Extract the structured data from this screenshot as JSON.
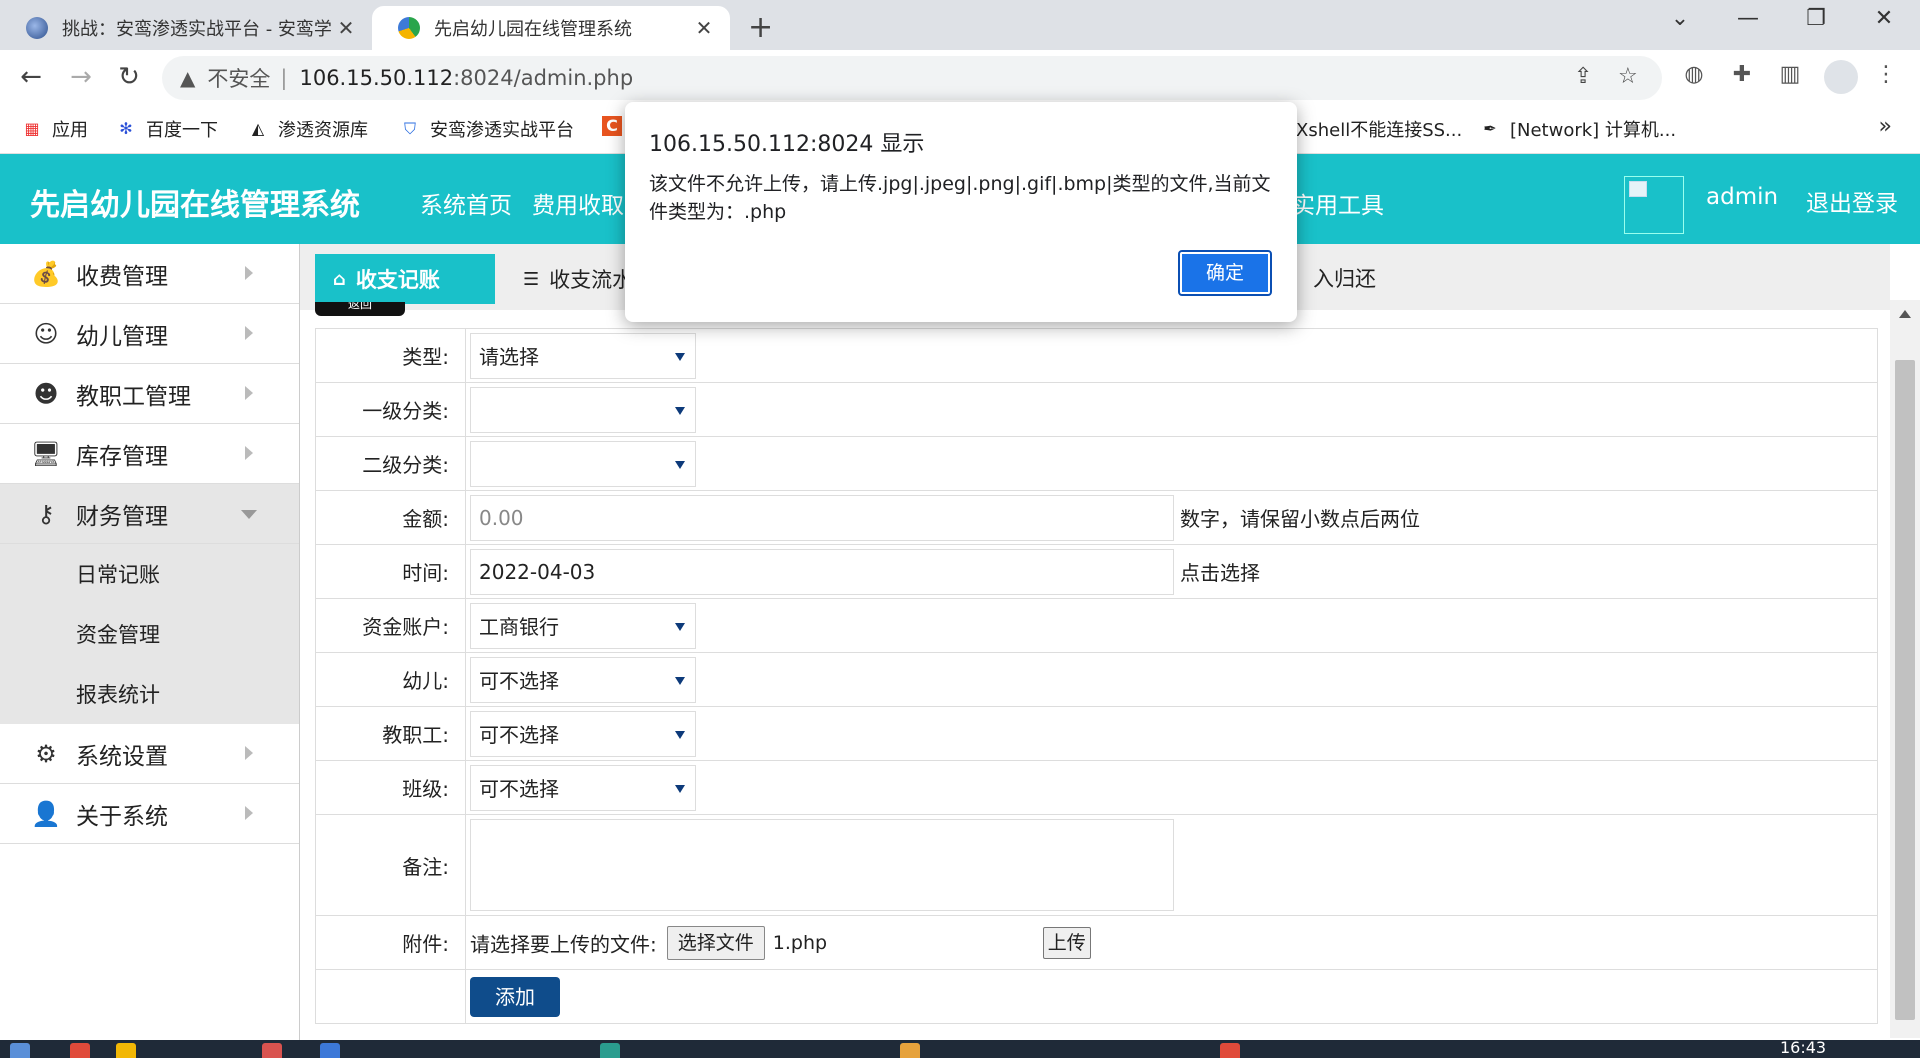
{
  "browser": {
    "tabs": [
      {
        "title": "挑战：安鸾渗透实战平台 - 安鸾学",
        "active": false
      },
      {
        "title": "先启幼儿园在线管理系统",
        "active": true
      }
    ],
    "address": {
      "security_label": "不安全",
      "host": "106.15.50.112",
      "path": ":8024/admin.php"
    },
    "bookmarks": [
      {
        "label": "应用",
        "icon": "apps-grid-icon"
      },
      {
        "label": "百度一下",
        "icon": "baidu-paw-icon"
      },
      {
        "label": "渗透资源库",
        "icon": "wolf-icon"
      },
      {
        "label": "安鸾渗透实战平台",
        "icon": "shield-icon"
      },
      {
        "label": "C",
        "icon": "csdn-icon"
      },
      {
        "label": "Xshell不能连接SS...",
        "icon": "none"
      },
      {
        "label": "[Network] 计算机...",
        "icon": "feather-icon"
      }
    ]
  },
  "app": {
    "title": "先启幼儿园在线管理系统",
    "nav": [
      "系统首页",
      "费用收取",
      "实用工具"
    ],
    "user": "admin",
    "logout": "退出登录"
  },
  "sidebar": {
    "items": [
      {
        "label": "收费管理",
        "icon": "money-bag-icon"
      },
      {
        "label": "幼儿管理",
        "icon": "child-icon"
      },
      {
        "label": "教职工管理",
        "icon": "teacher-icon"
      },
      {
        "label": "库存管理",
        "icon": "monitor-cart-icon"
      },
      {
        "label": "财务管理",
        "icon": "key-icon"
      },
      {
        "label": "系统设置",
        "icon": "gear-icon"
      },
      {
        "label": "关于系统",
        "icon": "user-icon"
      }
    ],
    "sub_items": [
      "日常记账",
      "资金管理",
      "报表统计"
    ]
  },
  "content": {
    "tabs": [
      "收支记账",
      "收支流水"
    ],
    "return_tab": "入归还",
    "back_button": "返回",
    "form": {
      "type_label": "类型:",
      "type_value": "请选择",
      "cat1_label": "一级分类:",
      "cat2_label": "二级分类:",
      "amount_label": "金额:",
      "amount_placeholder": "0.00",
      "amount_hint": "数字，请保留小数点后两位",
      "time_label": "时间:",
      "time_value": "2022-04-03",
      "time_hint": "点击选择",
      "account_label": "资金账户:",
      "account_value": "工商银行",
      "child_label": "幼儿:",
      "child_value": "可不选择",
      "staff_label": "教职工:",
      "staff_value": "可不选择",
      "class_label": "班级:",
      "class_value": "可不选择",
      "memo_label": "备注:",
      "attach_label": "附件:",
      "attach_prompt": "请选择要上传的文件:",
      "choose_file": "选择文件",
      "file_name": "1.php",
      "upload": "上传",
      "add": "添加"
    }
  },
  "dialog": {
    "title": "106.15.50.112:8024 显示",
    "message": "该文件不允许上传，请上传.jpg|.jpeg|.png|.gif|.bmp|类型的文件,当前文件类型为：.php",
    "ok": "确定"
  },
  "taskbar": {
    "clock": "16:43"
  },
  "colors": {
    "header": "#19c1c9",
    "primary_button": "#0f4c8b",
    "dialog_button": "#1a73e8"
  }
}
